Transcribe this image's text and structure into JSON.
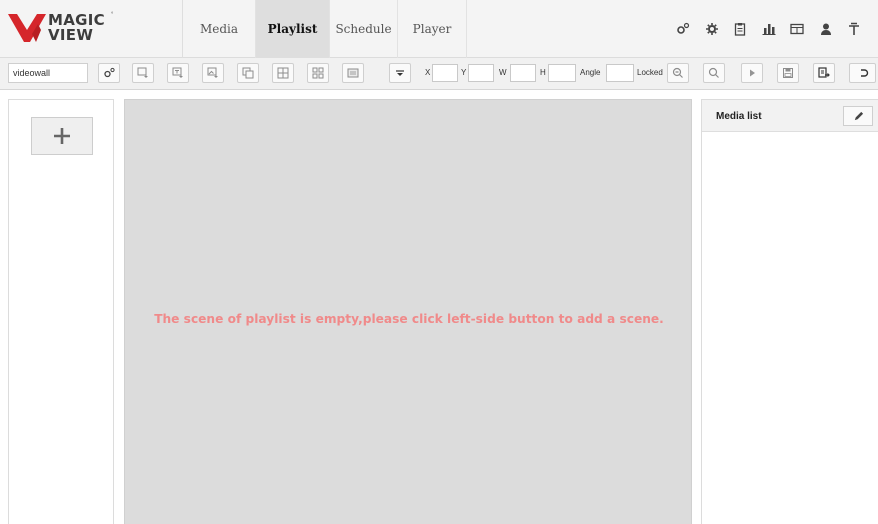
{
  "app": {
    "logo_line1": "MAGIC",
    "logo_line2": "VIEW",
    "logo_mark": "°",
    "brand_color": "#d5262b"
  },
  "nav": {
    "tabs": [
      {
        "label": "Media",
        "active": false
      },
      {
        "label": "Playlist",
        "active": true
      },
      {
        "label": "Schedule",
        "active": false
      },
      {
        "label": "Player",
        "active": false
      }
    ]
  },
  "header_icons": [
    "settings-gears-icon",
    "gear-icon",
    "clipboard-icon",
    "bar-chart-icon",
    "screen-icon",
    "user-icon",
    "pin-icon"
  ],
  "toolbar": {
    "layout_select": "videowall",
    "buttons": [
      "layout-settings-icon",
      "add-area-icon",
      "add-text-area-icon",
      "add-image-area-icon",
      "copy-area-icon",
      "grid-layout-icon",
      "tile-layout-icon",
      "background-icon",
      "dropdown-arrow-icon"
    ],
    "x_label": "X",
    "x_value": "",
    "y_label": "Y",
    "y_value": "",
    "w_label": "W",
    "w_value": "",
    "h_label": "H",
    "h_value": "",
    "angle_label": "Angle",
    "angle_value": "",
    "locked_label": "Locked",
    "right_buttons": [
      "zoom-out-icon",
      "zoom-in-icon",
      "play-icon",
      "save-icon",
      "export-icon",
      "undo-icon"
    ]
  },
  "scenes": {
    "add_label": "+"
  },
  "stage": {
    "empty_message": "The scene of playlist is empty,please click left-side button to add a scene.",
    "message_color": "#f08a8a"
  },
  "media_list": {
    "title": "Media list"
  }
}
